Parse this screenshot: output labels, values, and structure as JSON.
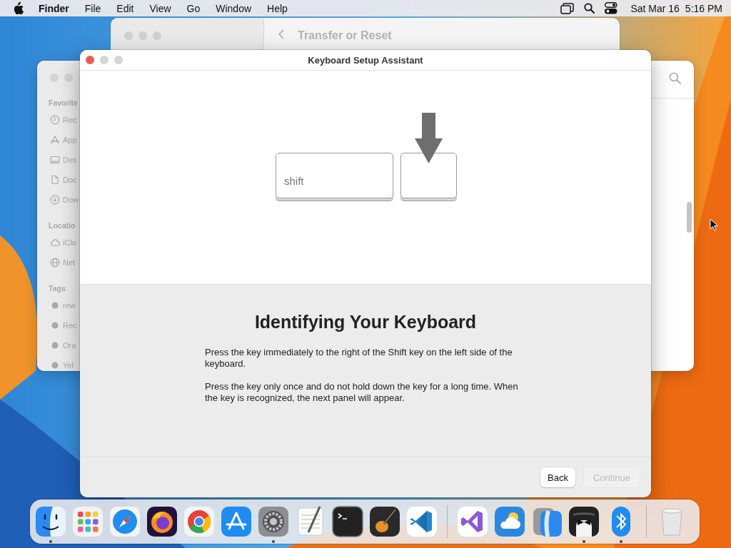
{
  "menu_bar": {
    "app": "Finder",
    "menus": [
      "File",
      "Edit",
      "View",
      "Go",
      "Window",
      "Help"
    ],
    "date": "Sat Mar 16",
    "time": "5:16 PM"
  },
  "background_window": {
    "title": "Transfer or Reset"
  },
  "finder_window": {
    "sections": [
      {
        "heading": "Favorite",
        "items": [
          {
            "label": "Rec",
            "kind": "clock"
          },
          {
            "label": "App",
            "kind": "apps"
          },
          {
            "label": "Des",
            "kind": "desktop"
          },
          {
            "label": "Doc",
            "kind": "document"
          },
          {
            "label": "Dow",
            "kind": "download"
          }
        ]
      },
      {
        "heading": "Locatio",
        "items": [
          {
            "label": "iClo",
            "kind": "cloud"
          },
          {
            "label": "Net",
            "kind": "globe"
          }
        ]
      },
      {
        "heading": "Tags",
        "items": [
          {
            "label": "rew",
            "kind": "tag"
          },
          {
            "label": "Rec",
            "kind": "tag"
          },
          {
            "label": "Ora",
            "kind": "tag"
          },
          {
            "label": "Yel",
            "kind": "tag"
          }
        ]
      }
    ]
  },
  "assistant_window": {
    "title": "Keyboard Setup Assistant",
    "key_label": "shift",
    "heading": "Identifying Your Keyboard",
    "paragraphs": [
      "Press the key immediately to the right of the Shift key on the left side of the keyboard.",
      "Press the key only once and do not hold down the key for a long time. When the key is recognized, the next panel will appear."
    ],
    "buttons": [
      {
        "label": "Back",
        "disabled": false
      },
      {
        "label": "Continue",
        "disabled": true
      }
    ]
  },
  "dock": {
    "sections": [
      {
        "items": [
          {
            "kind": "finder",
            "running": true
          },
          {
            "kind": "launchpad",
            "running": false
          },
          {
            "kind": "safari",
            "running": false
          },
          {
            "kind": "firefox",
            "running": false
          },
          {
            "kind": "chrome",
            "running": false
          },
          {
            "kind": "appstore",
            "running": false
          },
          {
            "kind": "settings",
            "running": true
          },
          {
            "kind": "textedit",
            "running": false
          },
          {
            "kind": "terminal",
            "running": false
          },
          {
            "kind": "garageband",
            "running": false
          },
          {
            "kind": "vscode",
            "running": false
          }
        ]
      },
      {
        "items": [
          {
            "kind": "visualstudio",
            "running": false
          },
          {
            "kind": "weather",
            "running": false
          },
          {
            "kind": "migration",
            "running": false
          },
          {
            "kind": "bartender",
            "running": true
          },
          {
            "kind": "bluetooth",
            "running": true
          }
        ]
      },
      {
        "items": [
          {
            "kind": "trash",
            "running": false
          }
        ]
      }
    ]
  }
}
